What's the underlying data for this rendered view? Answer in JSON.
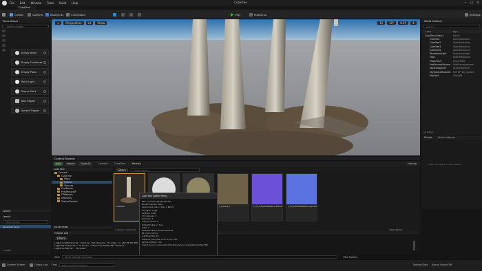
{
  "menubar": {
    "items": [
      "File",
      "Edit",
      "Window",
      "Tools",
      "Build",
      "Help"
    ],
    "window_title": "CubeTree"
  },
  "tab": {
    "label": "CubeTree"
  },
  "toolbar": {
    "save": "",
    "mode": "Create",
    "content": "Content",
    "blueprints": "Blueprints",
    "cinematics": "Cinematics",
    "play": "Play",
    "platforms": "Platforms",
    "settings": "Settings"
  },
  "place_actors": {
    "title": "Place Actors",
    "search_placeholder": "Search Classes",
    "items": [
      {
        "label": "Empty Actor",
        "icon": "sphere-icon"
      },
      {
        "label": "Empty Character",
        "icon": "character-icon"
      },
      {
        "label": "Empty Pawn",
        "icon": "pawn-icon"
      },
      {
        "label": "Point Light",
        "icon": "point-light-icon"
      },
      {
        "label": "Player Start",
        "icon": "player-start-icon"
      },
      {
        "label": "Box Trigger",
        "icon": "box-trigger-icon"
      },
      {
        "label": "Sphere Trigger",
        "icon": "sphere-trigger-icon"
      }
    ]
  },
  "viewport": {
    "perspective": "Perspective",
    "lit": "Lit",
    "show": "Show",
    "snap_values": [
      "10",
      "10°",
      "0.25",
      "4"
    ]
  },
  "outliner": {
    "title": "World Outliner",
    "search_placeholder": "Search...",
    "col_label": "Label",
    "col_type": "Type",
    "rows": [
      {
        "label": "CubeTree (Editor)",
        "type": "World"
      },
      {
        "label": "CubeTree",
        "type": "StaticMeshActor"
      },
      {
        "label": "CubeTree2",
        "type": "StaticMeshActor"
      },
      {
        "label": "CubeTree3",
        "type": "StaticMeshActor"
      },
      {
        "label": "CubeTree4",
        "type": "StaticMeshActor"
      },
      {
        "label": "DirectionalLight",
        "type": "DirectionalLight"
      },
      {
        "label": "Floor",
        "type": "StaticMeshActor"
      },
      {
        "label": "PlayerStart",
        "type": "PlayerStart"
      },
      {
        "label": "PostProcessVolume",
        "type": "PostProcessVolume"
      },
      {
        "label": "SkyAtmosphere",
        "type": "SkyAtmosphere"
      },
      {
        "label": "SkySphereBlueprint",
        "type": "Edit BP_Sky_Sphere"
      },
      {
        "label": "SkyLight",
        "type": "SkyLight"
      }
    ],
    "count": "11 actors"
  },
  "details": {
    "tab1": "Details",
    "tab2": "World Settings",
    "empty": "Select an object to view details."
  },
  "content_browser": {
    "title": "Content Browser",
    "add": "Add",
    "import": "Import",
    "save_all": "Save All",
    "breadcrumb": [
      "Content",
      "CubeTree",
      "Meshes"
    ],
    "settings": "Settings",
    "search_placeholder": "Search Meshes",
    "filters": "Filters",
    "tree_header": "CUBETREE",
    "tree": [
      {
        "label": "Content",
        "depth": 0
      },
      {
        "label": "CubeTree",
        "depth": 1
      },
      {
        "label": "Maps",
        "depth": 2
      },
      {
        "label": "Meshes",
        "depth": 2
      },
      {
        "label": "Textures",
        "depth": 2
      },
      {
        "label": "FirstPerson",
        "depth": 1
      },
      {
        "label": "FirstPersonBP",
        "depth": 1
      },
      {
        "label": "FPWeapon",
        "depth": 1
      },
      {
        "label": "Geometry",
        "depth": 1
      },
      {
        "label": "StarterContent",
        "depth": 1
      }
    ],
    "collections": "COLLECTIONS",
    "items_count": "6 items (1 selected)",
    "view_options": "View Options",
    "assets": [
      {
        "name": "CubeTree",
        "kind": "tree"
      },
      {
        "name": "M_SphereMat",
        "kind": "sphere-white"
      },
      {
        "name": "M_Moss",
        "kind": "sphere-moss"
      },
      {
        "name": "T_Ground_D",
        "kind": "ground"
      },
      {
        "name": "T_DS_CubeTreeMaterial_Normal",
        "kind": "normal-purple"
      },
      {
        "name": "T_DS_CubeTreeMaterial_Normal_2",
        "kind": "normal-blue"
      }
    ]
  },
  "tooltip": {
    "title": "CubeTree (Static Mesh)",
    "lines": [
      "Path: /Game/CubeTree/Meshes",
      "Nanite Enabled: False",
      "Approx Size: 99.0 x 99.1 x 289.3",
      "Triangles: 7,999",
      "Vertices: 5,024",
      "UV Channels: 2",
      "Materials: 1",
      "Collision Prims: 0",
      "Default Collision: True",
      "LODs: 1",
      "Default Collision Profile: BlockAll",
      "Minimum LOD: 0",
      "Lightmap Res: 64",
      "Distance Field Size: 131 x 131 x 128",
      "Simple Collision: Yes",
      "Import Source: G:/projects/CUA_Bionaly/source/assets/CubeTree.FBX"
    ]
  },
  "output_log": {
    "title": "Output Log",
    "filters": "Filters",
    "lines": [
      "LogDerivedDataCache: Display: Maintenance finished in +00:00:00.000 and deleted 0 files...",
      "LogShaderCompilers: Display: Compiling PCD3D_SM5 shaders...",
      "LogEditorServer: Finished."
    ],
    "cmd": "Cmd",
    "console_placeholder": "Enter Console Command",
    "view_options": "View Options"
  },
  "levels": {
    "title": "Levels",
    "levels_label": "Levels",
    "persistent": "Persistent Level",
    "search_placeholder": "Search Levels",
    "count": "1 levels"
  },
  "status": {
    "content_drawer": "Content Drawer",
    "output_log": "Output Log",
    "cmd": "Cmd",
    "console_placeholder": "Enter Console Command",
    "source_control": "Source Control Off",
    "derived_data": "Derived Data"
  },
  "colors": {
    "accent": "#1a8fe0",
    "play": "#3fbf3f",
    "folder": "#b7903d"
  }
}
